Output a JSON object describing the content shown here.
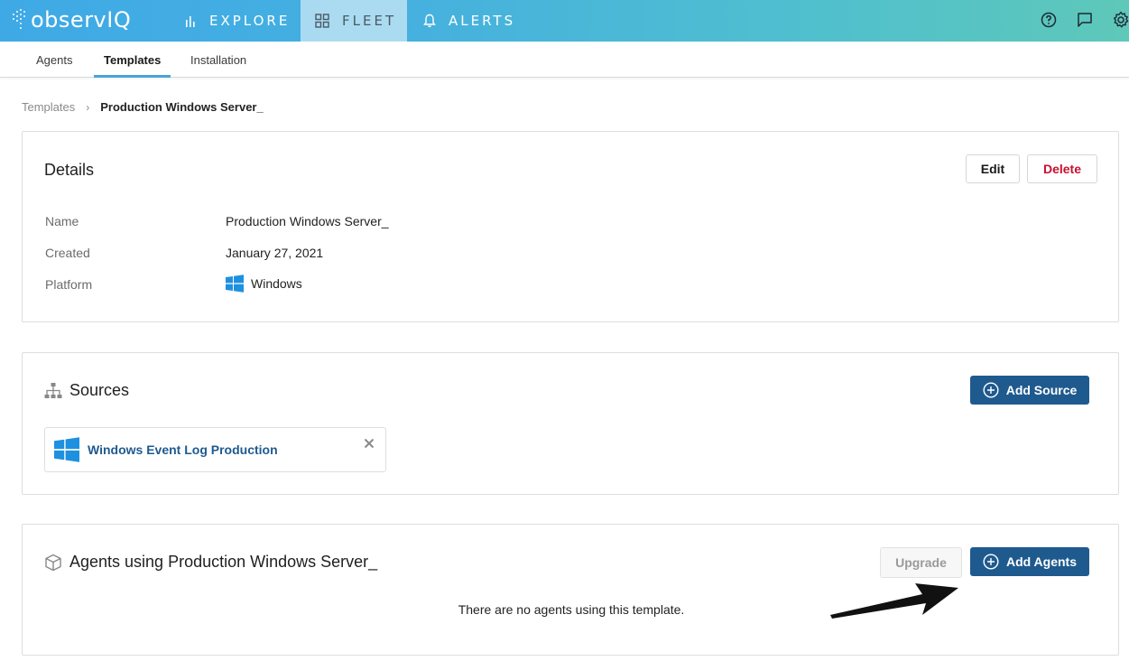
{
  "app": {
    "logo_text": "observIQ"
  },
  "nav": {
    "tabs": [
      {
        "label": "EXPLORE",
        "icon": "bar-chart-icon"
      },
      {
        "label": "FLEET",
        "icon": "grid-icon"
      },
      {
        "label": "ALERTS",
        "icon": "bell-icon"
      }
    ],
    "active_tab": "FLEET",
    "right_icons": [
      "help-circle-icon",
      "chat-icon",
      "settings-gear-icon"
    ]
  },
  "subnav": {
    "tabs": [
      {
        "label": "Agents"
      },
      {
        "label": "Templates"
      },
      {
        "label": "Installation"
      }
    ],
    "active_tab": "Templates"
  },
  "breadcrumb": {
    "parent": "Templates",
    "separator": "›",
    "current": "Production Windows Server_"
  },
  "details": {
    "title": "Details",
    "edit_label": "Edit",
    "delete_label": "Delete",
    "fields": [
      {
        "label": "Name",
        "value": "Production Windows Server_"
      },
      {
        "label": "Created",
        "value": "January 27, 2021"
      },
      {
        "label": "Platform",
        "value": "Windows"
      }
    ]
  },
  "sources": {
    "title": "Sources",
    "add_label": "Add Source",
    "items": [
      {
        "label": "Windows Event Log Production",
        "icon": "windows-logo-icon"
      }
    ]
  },
  "agents": {
    "title": "Agents using Production Windows Server_",
    "upgrade_label": "Upgrade",
    "add_label": "Add Agents",
    "empty_message": "There are no agents using this template."
  },
  "colors": {
    "primary": "#1f5a8f",
    "danger": "#c8102e",
    "nav_gradient_start": "#3fa9e6",
    "nav_gradient_end": "#5ec8b9",
    "tab_underline": "#4aa3d8"
  }
}
